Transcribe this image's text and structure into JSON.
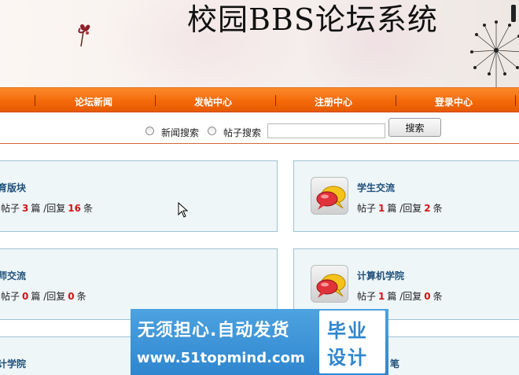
{
  "site": {
    "title": "校园BBS论坛系统"
  },
  "nav": {
    "items": [
      {
        "label": "论坛新闻"
      },
      {
        "label": "发帖中心"
      },
      {
        "label": "注册中心"
      },
      {
        "label": "登录中心"
      }
    ]
  },
  "search": {
    "options": [
      {
        "label": "新闻搜索",
        "selected": false
      },
      {
        "label": "帖子搜索",
        "selected": false
      }
    ],
    "input_value": "",
    "button_label": "搜索"
  },
  "boards": [
    {
      "name": "体育版块",
      "visible_name": "育版块",
      "posts_label": "帖子",
      "posts": "3",
      "posts_unit": "篇",
      "replies_label": "/回复",
      "replies": "16",
      "replies_unit": "条"
    },
    {
      "name": "学生交流",
      "posts_label": "帖子",
      "posts": "1",
      "posts_unit": "篇",
      "replies_label": "/回复",
      "replies": "2",
      "replies_unit": "条"
    },
    {
      "name": "教师交流",
      "visible_name": "师交流",
      "posts_label": "帖子",
      "posts": "0",
      "posts_unit": "篇",
      "replies_label": "/回复",
      "replies": "0",
      "replies_unit": "条"
    },
    {
      "name": "计算机学院",
      "posts_label": "帖子",
      "posts": "1",
      "posts_unit": "篇",
      "replies_label": "/回复",
      "replies": "0",
      "replies_unit": "条"
    },
    {
      "name": "会计学院",
      "visible_name": "计学院"
    },
    {
      "name": "笔",
      "visible_name": "笔"
    }
  ],
  "ad": {
    "line1": "无须担心.自动发货",
    "line2": "www.51topmind.com",
    "badge_line1": "毕业",
    "badge_line2": "设计"
  },
  "colors": {
    "nav_orange": "#f46a0a",
    "board_bg": "#eef6f8",
    "board_border": "#9fc3d2",
    "board_name": "#1e4f7a",
    "count_red": "#d41414",
    "ad_blue": "#2f86cf"
  }
}
